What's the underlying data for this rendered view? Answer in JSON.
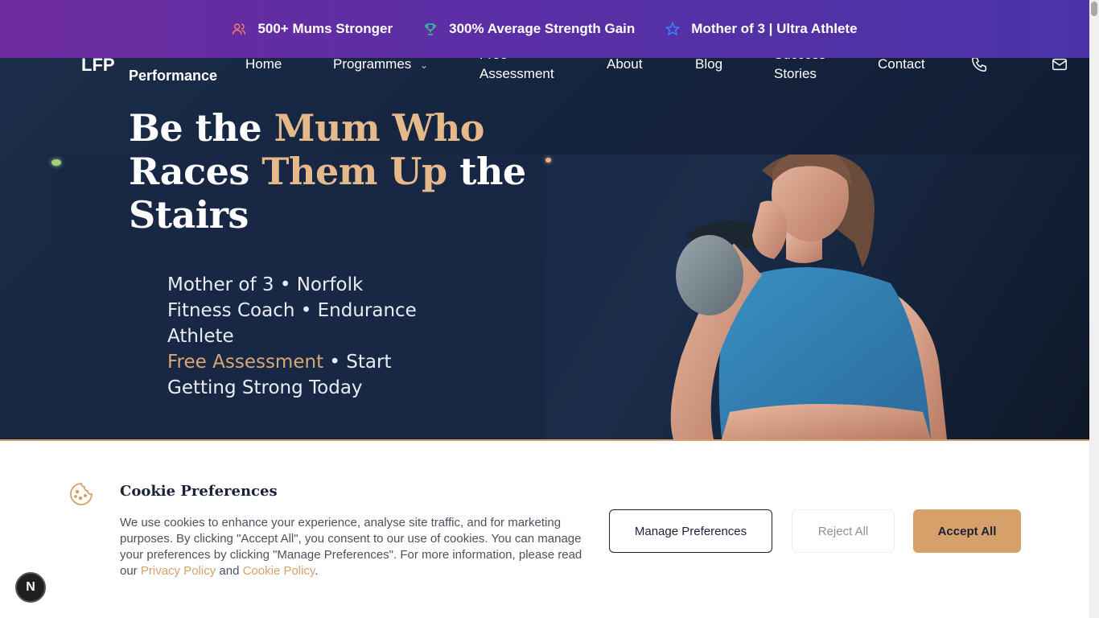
{
  "topbar": {
    "stats": [
      {
        "icon": "users-icon",
        "label": "500+ Mums Stronger",
        "color": "#f07a6a"
      },
      {
        "icon": "trophy-icon",
        "label": "300% Average Strength Gain",
        "color": "#2fc88a"
      },
      {
        "icon": "star-icon",
        "label": "Mother of 3 | Ultra Athlete",
        "color": "#3b82f6"
      }
    ]
  },
  "nav": {
    "logo": "LFP",
    "brand_sub": "Performance",
    "links": {
      "home": "Home",
      "programmes": "Programmes",
      "free_assessment": "Free Assessment",
      "about": "About",
      "blog": "Blog",
      "success_stories": "Success Stories",
      "contact": "Contact"
    }
  },
  "hero": {
    "headline_parts": [
      "Be the ",
      "Mum Who",
      " Races ",
      "Them Up",
      " the Stairs"
    ],
    "sub_line1": "Mother of 3 • Norfolk Fitness Coach • Endurance Athlete",
    "sub_link": "Free Assessment",
    "sub_line2": " • Start Getting Strong Today"
  },
  "cookie": {
    "title": "Cookie Preferences",
    "text_before": "We use cookies to enhance your experience, analyse site traffic, and for marketing purposes. By clicking \"Accept All\", you consent to our use of cookies. You can manage your preferences by clicking \"Manage Preferences\". For more information, please read our ",
    "privacy_link": "Privacy Policy",
    "and": " and ",
    "cookie_link": "Cookie Policy",
    "period": ".",
    "manage": "Manage Preferences",
    "reject": "Reject All",
    "accept": "Accept All"
  },
  "badge": "N",
  "colors": {
    "accent": "#d6a06b",
    "navy": "#15243f",
    "purple": "#5b2fa6"
  }
}
